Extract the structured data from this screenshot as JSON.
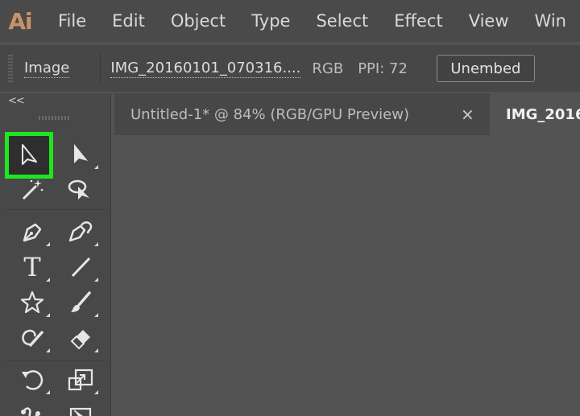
{
  "app": {
    "logo_text": "Ai"
  },
  "menu": {
    "items": [
      "File",
      "Edit",
      "Object",
      "Type",
      "Select",
      "Effect",
      "View",
      "Win"
    ]
  },
  "control_bar": {
    "object_type": "Image",
    "file_name": "IMG_20160101_070316....",
    "color_mode": "RGB",
    "ppi": "PPI: 72",
    "unembed_label": "Unembed"
  },
  "toolbar": {
    "collapse_glyph": "<<",
    "selected_tool": "selection-tool",
    "tools": [
      "selection-tool",
      "direct-selection-tool",
      "magic-wand-tool",
      "lasso-tool",
      "pen-tool",
      "curvature-tool",
      "type-tool",
      "line-segment-tool",
      "star-tool",
      "paintbrush-tool",
      "shaper-tool",
      "eraser-tool",
      "rotate-tool",
      "scale-tool",
      "puppet-warp-tool",
      "free-transform-tool"
    ],
    "type_tool_glyph": "T"
  },
  "tabs": [
    {
      "label": "Untitled-1* @ 84% (RGB/GPU Preview)",
      "active": false,
      "close_glyph": "×"
    },
    {
      "label": "IMG_2016",
      "active": true
    }
  ],
  "colors": {
    "brand": "#c9916a",
    "highlight": "#1ee61e",
    "canvas": "#535353"
  }
}
